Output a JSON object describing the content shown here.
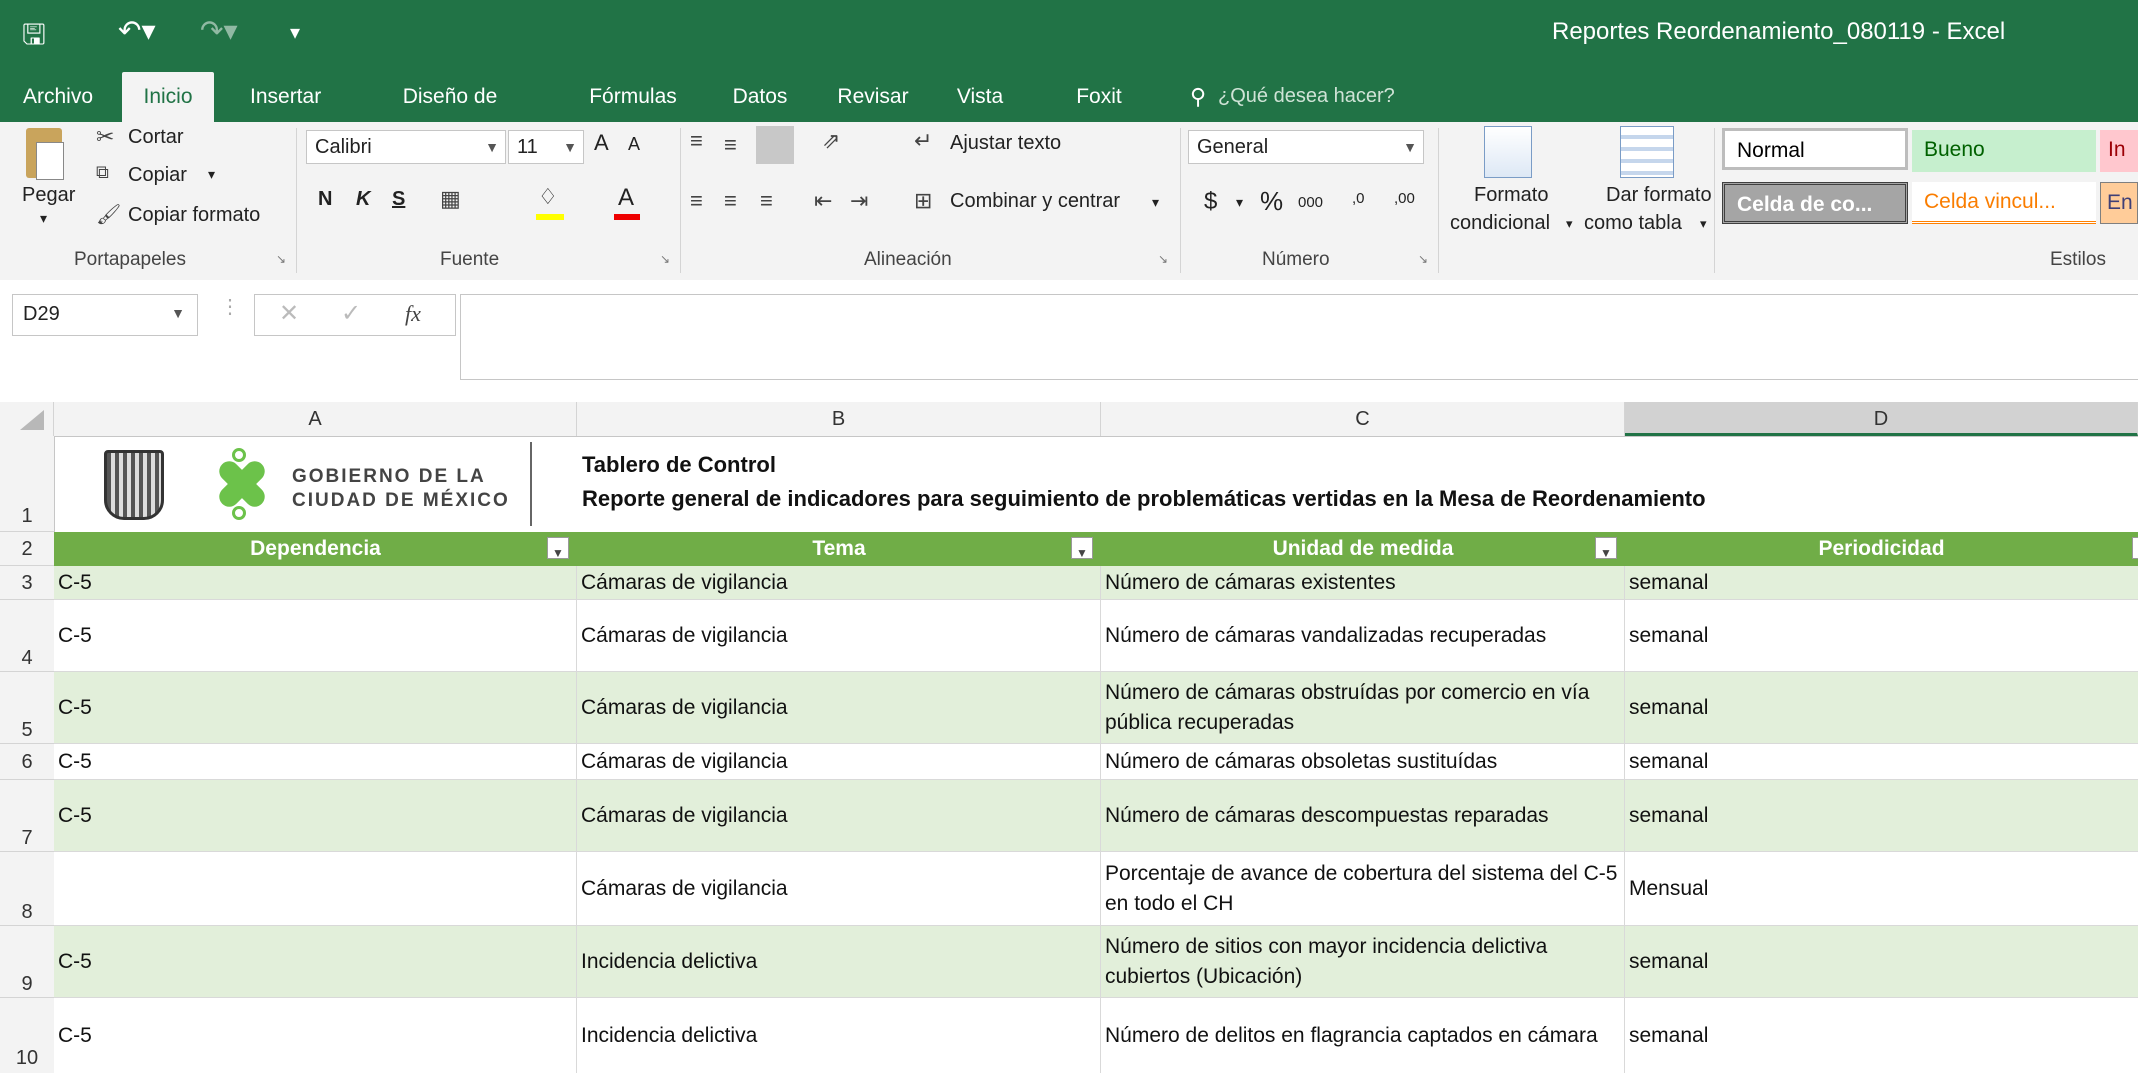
{
  "window": {
    "title": "Reportes Reordenamiento_080119 - Excel"
  },
  "tabs": [
    "Archivo",
    "Inicio",
    "Insertar",
    "Diseño de página",
    "Fórmulas",
    "Datos",
    "Revisar",
    "Vista",
    "Foxit PDF"
  ],
  "tellme": "¿Qué desea hacer?",
  "ribbon": {
    "clipboard": {
      "paste": "Pegar",
      "cut": "Cortar",
      "copy": "Copiar",
      "format_painter": "Copiar formato",
      "label": "Portapapeles"
    },
    "font": {
      "name": "Calibri",
      "size": "11",
      "bold": "N",
      "italic": "K",
      "underline": "S",
      "grow": "A",
      "shrink": "A",
      "label": "Fuente"
    },
    "alignment": {
      "wrap": "Ajustar texto",
      "merge": "Combinar y centrar",
      "label": "Alineación"
    },
    "number": {
      "format": "General",
      "currency": "$",
      "percent": "%",
      "thousands": "000",
      "inc": ",0",
      "dec": ",00",
      "label": "Número"
    },
    "styles": {
      "cond_format_1": "Formato",
      "cond_format_2": "condicional",
      "as_table_1": "Dar formato",
      "as_table_2": "como tabla",
      "normal": "Normal",
      "good": "Bueno",
      "bad": "In",
      "check_cell": "Celda de co...",
      "linked_cell": "Celda vincul...",
      "input": "En",
      "label": "Estilos"
    }
  },
  "formula_bar": {
    "name_box": "D29",
    "fx": "fx",
    "value": ""
  },
  "grid": {
    "columns": [
      "A",
      "B",
      "C",
      "D"
    ],
    "rows": [
      "1",
      "2",
      "3",
      "4",
      "5",
      "6",
      "7",
      "8",
      "9",
      "10"
    ],
    "logo": {
      "line1": "GOBIERNO DE LA",
      "line2": "CIUDAD DE MÉXICO"
    },
    "title_line1": "Tablero de Control",
    "title_line2": "Reporte general de indicadores para seguimiento de problemáticas vertidas en la Mesa de Reordenamiento",
    "headers": [
      "Dependencia",
      "Tema",
      "Unidad de medida",
      "Periodicidad"
    ],
    "data": [
      [
        "C-5",
        "Cámaras de vigilancia",
        "Número de cámaras existentes",
        "semanal"
      ],
      [
        "C-5",
        "Cámaras de vigilancia",
        "Número de cámaras vandalizadas recuperadas",
        "semanal"
      ],
      [
        "C-5",
        "Cámaras de vigilancia",
        "Número de cámaras obstruídas por comercio en vía pública recuperadas",
        "semanal"
      ],
      [
        "C-5",
        "Cámaras de vigilancia",
        "Número de cámaras obsoletas sustituídas",
        "semanal"
      ],
      [
        "C-5",
        "Cámaras de vigilancia",
        "Número de cámaras descompuestas reparadas",
        "semanal"
      ],
      [
        "",
        "Cámaras de vigilancia",
        "Porcentaje de avance de cobertura del sistema del C-5 en todo el CH",
        "Mensual"
      ],
      [
        "C-5",
        "Incidencia delictiva",
        "Número de sitios con mayor incidencia delictiva cubiertos (Ubicación)",
        "semanal"
      ],
      [
        "C-5",
        "Incidencia delictiva",
        "Número de delitos en flagrancia captados en cámara",
        "semanal"
      ]
    ]
  },
  "colors": {
    "excel_green": "#217346",
    "table_header": "#70ad47",
    "band": "#e2efda"
  }
}
